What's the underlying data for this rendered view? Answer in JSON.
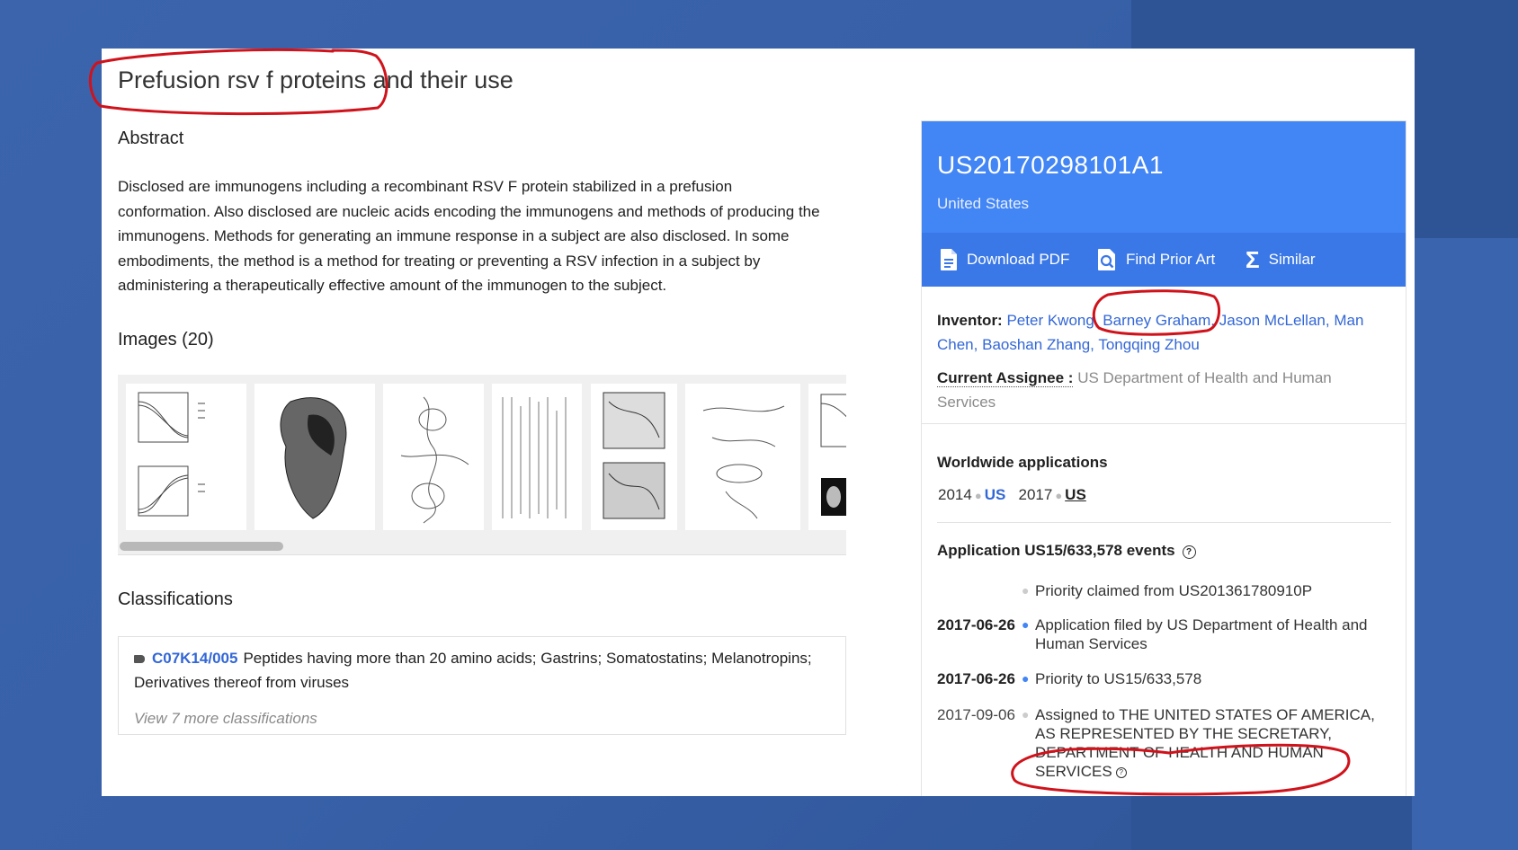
{
  "patent": {
    "title": "Prefusion rsv f proteins and their use",
    "abstract_heading": "Abstract",
    "abstract_text": "Disclosed are immunogens including a recombinant RSV F protein stabilized in a prefusion conformation. Also disclosed are nucleic acids encoding the immunogens and methods of producing the immunogens. Methods for generating an immune response in a subject are also disclosed. In some embodiments, the method is a method for treating or preventing a RSV infection in a subject by administering a therapeutically effective amount of the immunogen to the subject.",
    "images_heading": "Images (20)",
    "classifications": {
      "heading": "Classifications",
      "code": "C07K14/005",
      "description": "Peptides having more than 20 amino acids; Gastrins; Somatostatins; Melanotropins; Derivatives thereof from viruses",
      "view_more": "View 7 more classifications"
    }
  },
  "sidebar": {
    "number": "US20170298101A1",
    "country": "United States",
    "actions": {
      "download_pdf": "Download PDF",
      "find_prior_art": "Find Prior Art",
      "similar": "Similar"
    },
    "inventor_label": "Inventor:",
    "inventors": [
      "Peter Kwong",
      "Barney Graham",
      "Jason McLellan",
      "Man Chen",
      "Baoshan Zhang",
      "Tongqing Zhou"
    ],
    "assignee_label": "Current Assignee :",
    "assignee": "US Department of Health and Human Services",
    "worldwide": {
      "heading": "Worldwide applications",
      "year1": "2014",
      "country1": "US",
      "year2": "2017",
      "country2": "US"
    },
    "events": {
      "heading": "Application US15/633,578 events",
      "items": [
        {
          "date": "",
          "text": "Priority claimed from US201361780910P"
        },
        {
          "date": "2017-06-26",
          "text": "Application filed by US Department of Health and Human Services"
        },
        {
          "date": "2017-06-26",
          "text": "Priority to US15/633,578"
        },
        {
          "date": "2017-09-06",
          "text": "Assigned to THE UNITED STATES OF AMERICA, AS REPRESENTED BY THE SECRETARY, DEPARTMENT OF HEALTH AND HUMAN SERVICES"
        }
      ]
    }
  },
  "colors": {
    "accent_blue": "#4285f4",
    "action_bar_blue": "#3b78e7",
    "link_blue": "#3367d6",
    "annotation_red": "#d0121b"
  }
}
